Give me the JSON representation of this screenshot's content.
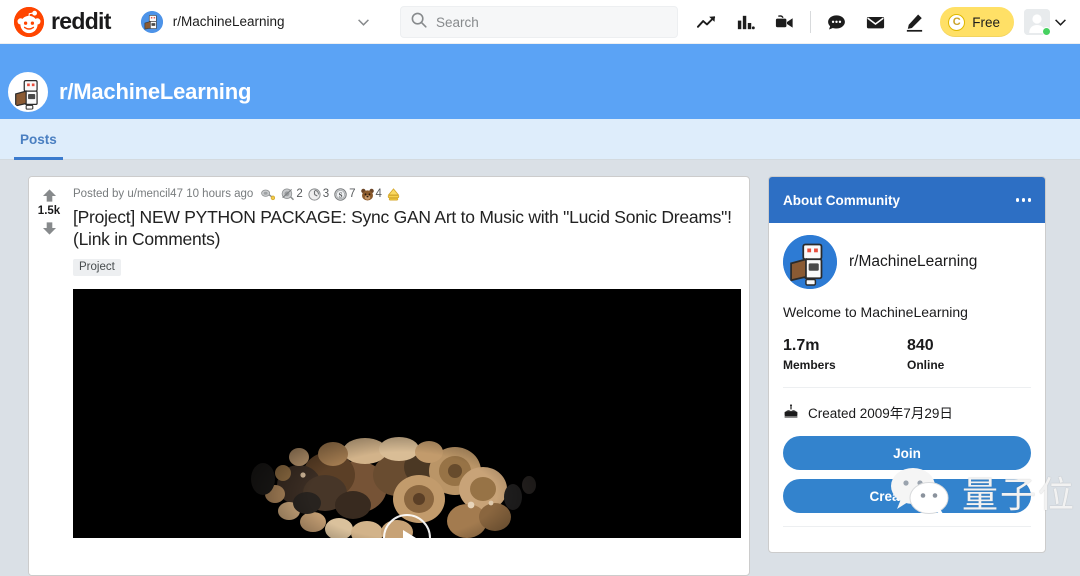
{
  "topnav": {
    "brand": "reddit",
    "brand_icon": "reddit-alien-icon",
    "community_picker": {
      "label": "r/MachineLearning",
      "avatar_icon": "machinelearning-avatar-icon",
      "caret_icon": "chevron-down-icon"
    },
    "search": {
      "placeholder": "Search",
      "value": "",
      "icon": "search-icon"
    },
    "icons": [
      {
        "name": "trending-up-icon",
        "title": "Trending"
      },
      {
        "name": "bar-chart-icon",
        "title": "Popular"
      },
      {
        "name": "video-camera-icon",
        "title": "Live"
      },
      {
        "name": "chat-bubble-icon",
        "title": "Chat"
      },
      {
        "name": "envelope-icon",
        "title": "Messages"
      },
      {
        "name": "pencil-icon",
        "title": "Create Post"
      }
    ],
    "free_badge": {
      "label": "Free",
      "coin_glyph": "C",
      "icon": "coin-icon",
      "color": "#FFE066"
    },
    "user": {
      "avatar_icon": "user-avatar-icon",
      "online_status": "online",
      "caret_icon": "chevron-down-icon"
    }
  },
  "banner": {
    "community_name": "r/MachineLearning",
    "avatar_icon": "machinelearning-avatar-icon",
    "color": "#5BA3F5"
  },
  "tabs": [
    {
      "label": "Posts",
      "active": true
    }
  ],
  "post": {
    "votes": "1.5k",
    "upvote_icon": "upvote-arrow-icon",
    "downvote_icon": "downvote-arrow-icon",
    "posted_by_prefix": "Posted by",
    "author": "u/mencil47",
    "timestamp": "10 hours ago",
    "awards": [
      {
        "name": "silver-award",
        "count": "",
        "icon": "award-badge-icon"
      },
      {
        "name": "helpful-award",
        "count": "2",
        "icon": "award-badge-icon"
      },
      {
        "name": "wholesome-award",
        "count": "3",
        "icon": "award-badge-icon"
      },
      {
        "name": "silver-s-award",
        "count": "7",
        "icon": "award-badge-icon"
      },
      {
        "name": "bear-award",
        "count": "4",
        "icon": "award-badge-icon"
      },
      {
        "name": "gold-award",
        "count": "",
        "icon": "award-badge-icon"
      }
    ],
    "title": "[Project] NEW PYTHON PACKAGE: Sync GAN Art to Music with \"Lucid Sonic Dreams\"! (Link in Comments)",
    "flair": "Project",
    "media": {
      "type": "video",
      "play_icon": "play-button-icon",
      "background": "#000000"
    }
  },
  "sidebar": {
    "header": {
      "title": "About Community",
      "menu_icon": "overflow-menu-icon",
      "color": "#2D6FC4"
    },
    "community_name": "r/MachineLearning",
    "community_avatar_icon": "machinelearning-avatar-icon",
    "description": "Welcome to MachineLearning",
    "stats": [
      {
        "value": "1.7m",
        "label": "Members"
      },
      {
        "value": "840",
        "label": "Online"
      }
    ],
    "created": {
      "icon": "cake-icon",
      "text": "Created 2009年7月29日"
    },
    "join_button": "Join",
    "create_post_button": "Create Post",
    "accent_color": "#3383CD"
  },
  "watermark": {
    "icon": "wechat-logo-icon",
    "text": "量子位"
  }
}
